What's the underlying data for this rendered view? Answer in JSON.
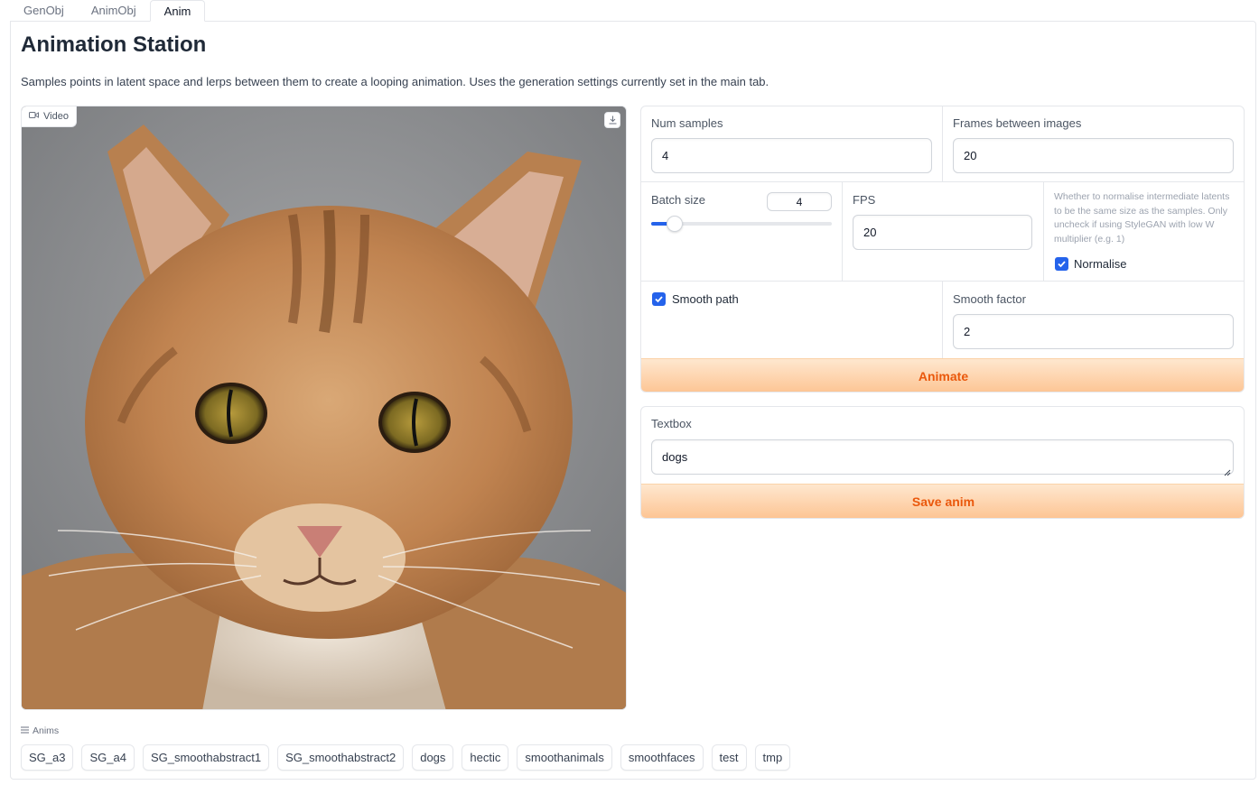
{
  "tabs": [
    "GenObj",
    "AnimObj",
    "Anim"
  ],
  "active_tab": "Anim",
  "page": {
    "title": "Animation Station",
    "description": "Samples points in latent space and lerps between them to create a looping animation. Uses the generation settings currently set in the main tab."
  },
  "video": {
    "label": "Video",
    "download_icon": "download-icon",
    "camera_icon": "video-camera-icon"
  },
  "form": {
    "num_samples_label": "Num samples",
    "num_samples_value": "4",
    "frames_label": "Frames between images",
    "frames_value": "20",
    "batch_size_label": "Batch size",
    "batch_size_value": "4",
    "batch_size_slider_fraction": 0.13,
    "fps_label": "FPS",
    "fps_value": "20",
    "normalise_note": "Whether to normalise intermediate latents to be the same size as the samples. Only uncheck if using StyleGAN with low W multiplier (e.g. 1)",
    "normalise_label": "Normalise",
    "normalise_checked": true,
    "smooth_path_label": "Smooth path",
    "smooth_path_checked": true,
    "smooth_factor_label": "Smooth factor",
    "smooth_factor_value": "2",
    "animate_button": "Animate"
  },
  "textbox": {
    "label": "Textbox",
    "value": "dogs",
    "save_button": "Save anim"
  },
  "anims": {
    "label": "Anims",
    "items": [
      "SG_a3",
      "SG_a4",
      "SG_smoothabstract1",
      "SG_smoothabstract2",
      "dogs",
      "hectic",
      "smoothanimals",
      "smoothfaces",
      "test",
      "tmp"
    ]
  },
  "colors": {
    "accent_blue": "#2563eb",
    "button_orange_text": "#ea580c",
    "button_gradient_top": "#fee7cf",
    "button_gradient_bottom": "#fdc594"
  }
}
